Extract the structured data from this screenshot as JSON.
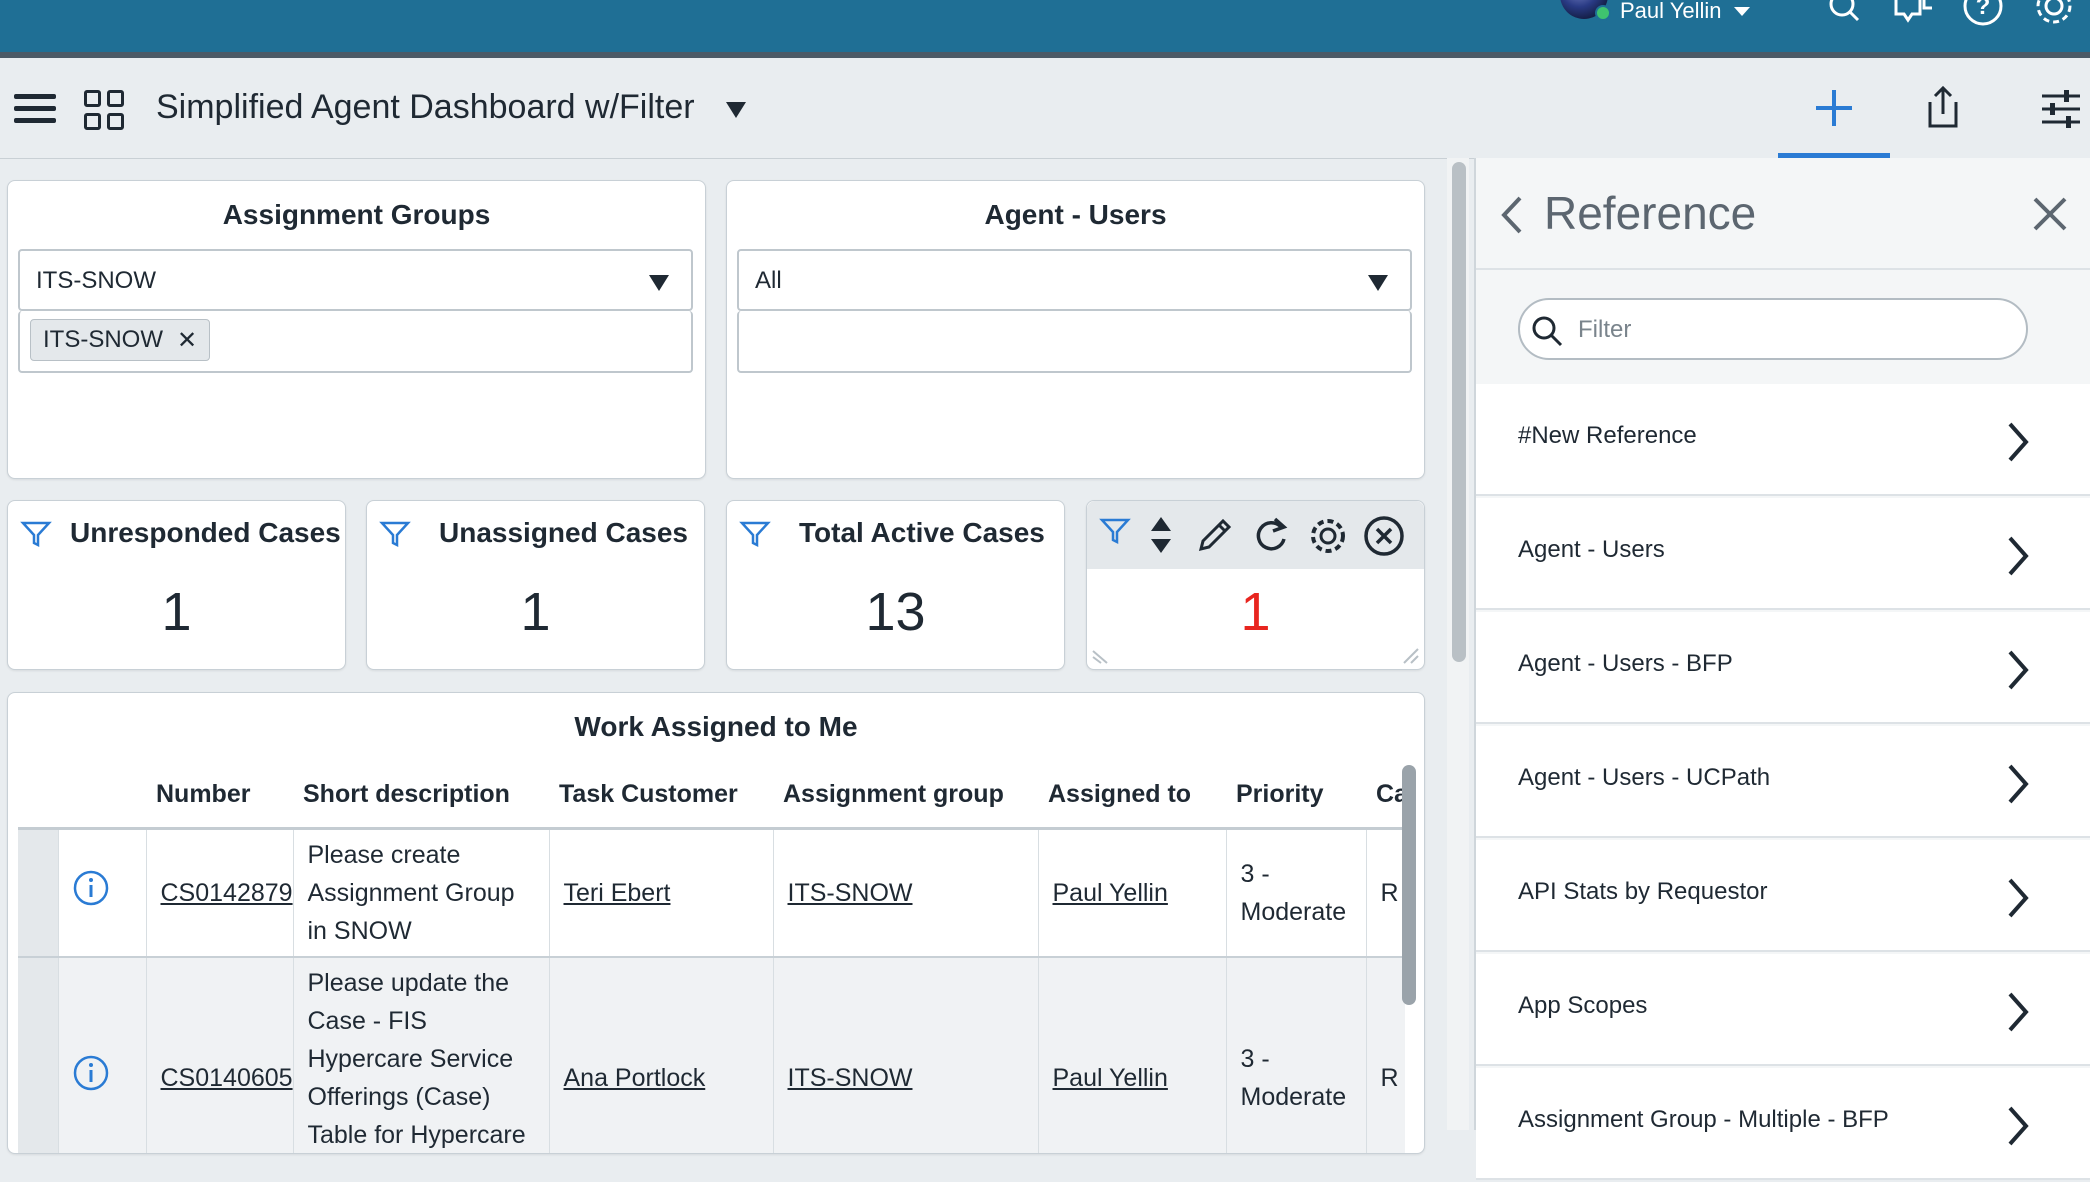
{
  "topnav": {
    "user_name": "Paul Yellin"
  },
  "titlebar": {
    "title": "Simplified Agent Dashboard w/Filter"
  },
  "assignment_groups": {
    "title": "Assignment Groups",
    "selected": "ITS-SNOW",
    "chip": "ITS-SNOW"
  },
  "agent_users": {
    "title": "Agent - Users",
    "selected": "All"
  },
  "stats": [
    {
      "title": "Unresponded Cases",
      "value": "1"
    },
    {
      "title": "Unassigned Cases",
      "value": "1"
    },
    {
      "title": "Total Active Cases",
      "value": "13"
    },
    {
      "title": "",
      "value": "1"
    }
  ],
  "work": {
    "title": "Work Assigned to Me",
    "columns": [
      "Number",
      "Short description",
      "Task Customer",
      "Assignment group",
      "Assigned to",
      "Priority",
      "Ca"
    ],
    "rows": [
      {
        "number": "CS0142879",
        "short_description": "Please create Assignment Group in SNOW",
        "task_customer": "Teri Ebert",
        "assignment_group": "ITS-SNOW",
        "assigned_to": "Paul Yellin",
        "priority": "3 - Moderate",
        "ca": "R"
      },
      {
        "number": "CS0140605",
        "short_description": "Please update the Case - FIS Hypercare Service Offerings (Case) Table for Hypercare Reporting",
        "task_customer": "Ana Portlock",
        "assignment_group": "ITS-SNOW",
        "assigned_to": "Paul Yellin",
        "priority": "3 - Moderate",
        "ca": "R"
      }
    ]
  },
  "panel": {
    "title": "Reference",
    "search_placeholder": "Filter",
    "items": [
      "#New Reference",
      "Agent - Users",
      "Agent - Users - BFP",
      "Agent - Users - UCPath",
      "API Stats by Requestor",
      "App Scopes",
      "Assignment Group -  Multiple - BFP"
    ]
  },
  "colors": {
    "topnav": "#1f6f95",
    "accent": "#2a7bd4",
    "alert_value": "#e8251f"
  },
  "icons": [
    "search-icon",
    "chat-icon",
    "help-icon",
    "gear-icon",
    "hamburger-icon",
    "grid-icon",
    "plus-icon",
    "share-icon",
    "sliders-icon",
    "filter-icon",
    "sort-icon",
    "pencil-icon",
    "refresh-icon",
    "close-circle-icon",
    "info-icon",
    "chevron-left-icon",
    "close-icon",
    "chevron-right-icon"
  ]
}
